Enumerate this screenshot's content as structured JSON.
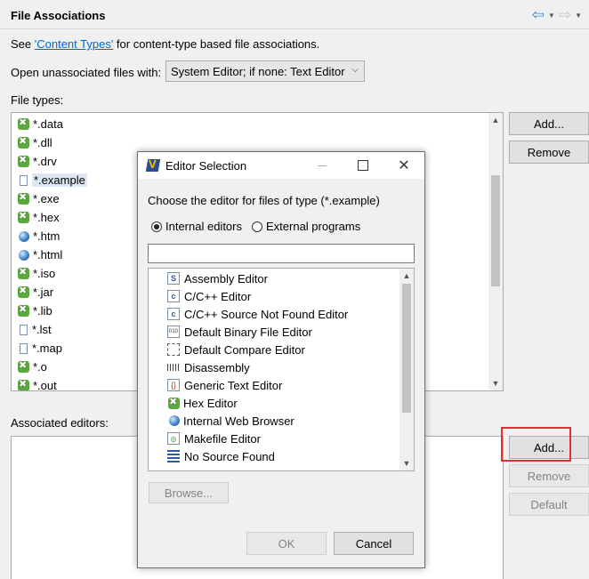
{
  "header": {
    "title": "File Associations",
    "back_icon": "arrow-left-icon",
    "forward_icon": "arrow-right-icon"
  },
  "intro": {
    "prefix": "See ",
    "link": "'Content Types'",
    "suffix": " for content-type based file associations."
  },
  "open_unassociated": {
    "label": "Open unassociated files with:",
    "selected": "System Editor; if none: Text Editor"
  },
  "file_types": {
    "label": "File types:",
    "items": [
      {
        "name": "*.data",
        "icon": "hex-icon"
      },
      {
        "name": "*.dll",
        "icon": "hex-icon"
      },
      {
        "name": "*.drv",
        "icon": "hex-icon"
      },
      {
        "name": "*.example",
        "icon": "file-icon"
      },
      {
        "name": "*.exe",
        "icon": "hex-icon"
      },
      {
        "name": "*.hex",
        "icon": "hex-icon"
      },
      {
        "name": "*.htm",
        "icon": "globe-icon"
      },
      {
        "name": "*.html",
        "icon": "globe-icon"
      },
      {
        "name": "*.iso",
        "icon": "hex-icon"
      },
      {
        "name": "*.jar",
        "icon": "hex-icon"
      },
      {
        "name": "*.lib",
        "icon": "hex-icon"
      },
      {
        "name": "*.lst",
        "icon": "file-icon"
      },
      {
        "name": "*.map",
        "icon": "file-icon"
      },
      {
        "name": "*.o",
        "icon": "hex-icon"
      },
      {
        "name": "*.out",
        "icon": "hex-icon"
      }
    ],
    "selected_index": 3,
    "add_label": "Add...",
    "remove_label": "Remove"
  },
  "associated_editors": {
    "label": "Associated editors:",
    "add_label": "Add...",
    "remove_label": "Remove",
    "default_label": "Default"
  },
  "dialog": {
    "title": "Editor Selection",
    "choose_text": "Choose the editor for files of type (*.example)",
    "radio_internal": "Internal editors",
    "radio_external": "External programs",
    "filter_value": "",
    "editors": [
      {
        "name": "Assembly Editor",
        "icon": "asm-icon"
      },
      {
        "name": "C/C++ Editor",
        "icon": "c-file-icon"
      },
      {
        "name": "C/C++ Source Not Found Editor",
        "icon": "c-file-icon"
      },
      {
        "name": "Default Binary File Editor",
        "icon": "binary-icon"
      },
      {
        "name": "Default Compare Editor",
        "icon": "compare-icon"
      },
      {
        "name": "Disassembly",
        "icon": "disassembly-icon"
      },
      {
        "name": "Generic Text Editor",
        "icon": "text-icon"
      },
      {
        "name": "Hex Editor",
        "icon": "hex-icon"
      },
      {
        "name": "Internal Web Browser",
        "icon": "globe-icon"
      },
      {
        "name": "Makefile Editor",
        "icon": "makefile-icon"
      },
      {
        "name": "No Source Found",
        "icon": "lines-icon"
      }
    ],
    "browse_label": "Browse...",
    "ok_label": "OK",
    "cancel_label": "Cancel"
  }
}
